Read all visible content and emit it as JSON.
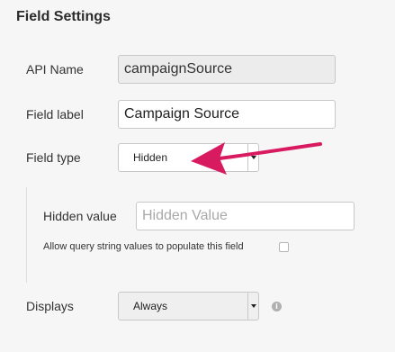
{
  "panel": {
    "title": "Field Settings"
  },
  "fields": {
    "api_name": {
      "label": "API Name",
      "value": "campaignSource"
    },
    "field_label": {
      "label": "Field label",
      "value": "Campaign Source"
    },
    "field_type": {
      "label": "Field type",
      "selected": "Hidden"
    },
    "hidden_value": {
      "label": "Hidden value",
      "placeholder": "Hidden Value"
    },
    "query_string": {
      "label": "Allow query string values to populate this field",
      "checked": false
    },
    "displays": {
      "label": "Displays",
      "selected": "Always"
    }
  },
  "annotation": {
    "arrow_color": "#d81b60"
  },
  "icons": {
    "info": "info-icon",
    "dropdown": "chevron-down-icon"
  }
}
